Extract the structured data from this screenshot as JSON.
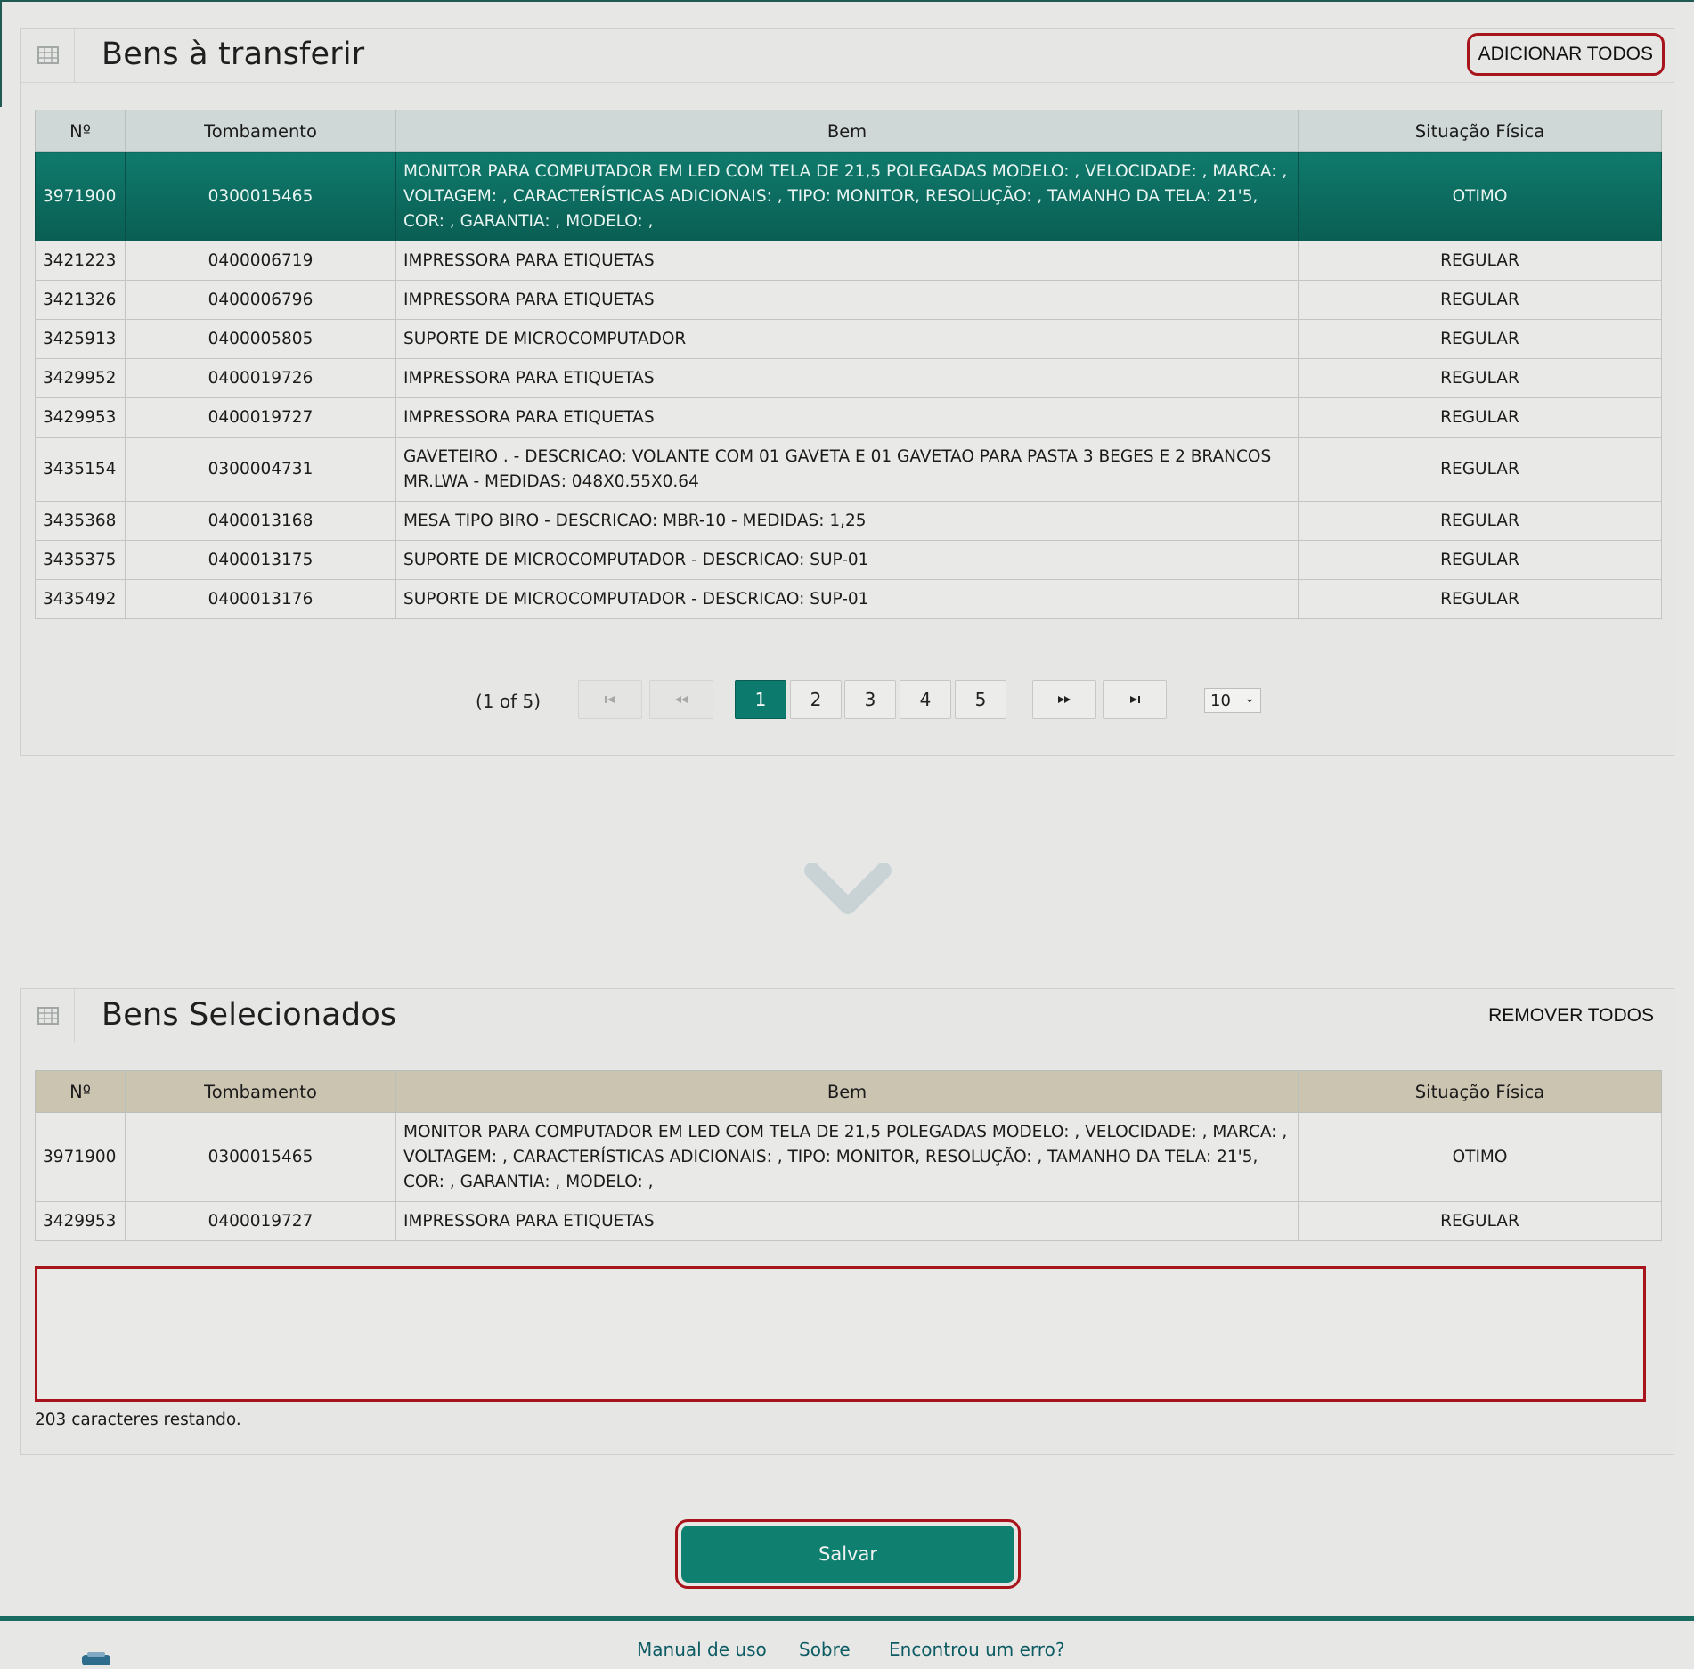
{
  "top_panel": {
    "title": "Bens à transferir",
    "action_label": "ADICIONAR TODOS",
    "columns": [
      "Nº",
      "Tombamento",
      "Bem",
      "Situação Física"
    ],
    "rows": [
      {
        "n": "3971900",
        "tomb": "0300015465",
        "bem": "MONITOR PARA COMPUTADOR EM LED COM TELA DE 21,5 POLEGADAS MODELO: , VELOCIDADE: , MARCA: , VOLTAGEM: , CARACTERÍSTICAS ADICIONAIS: , TIPO: MONITOR, RESOLUÇÃO: , TAMANHO DA TELA: 21'5, COR: , GARANTIA: , MODELO: ,",
        "sit": "OTIMO"
      },
      {
        "n": "3421223",
        "tomb": "0400006719",
        "bem": "IMPRESSORA PARA ETIQUETAS",
        "sit": "REGULAR"
      },
      {
        "n": "3421326",
        "tomb": "0400006796",
        "bem": "IMPRESSORA PARA ETIQUETAS",
        "sit": "REGULAR"
      },
      {
        "n": "3425913",
        "tomb": "0400005805",
        "bem": "SUPORTE DE MICROCOMPUTADOR",
        "sit": "REGULAR"
      },
      {
        "n": "3429952",
        "tomb": "0400019726",
        "bem": "IMPRESSORA PARA ETIQUETAS",
        "sit": "REGULAR"
      },
      {
        "n": "3429953",
        "tomb": "0400019727",
        "bem": "IMPRESSORA PARA ETIQUETAS",
        "sit": "REGULAR"
      },
      {
        "n": "3435154",
        "tomb": "0300004731",
        "bem": "GAVETEIRO . - DESCRICAO: VOLANTE COM 01 GAVETA E 01 GAVETAO PARA PASTA 3 BEGES E 2 BRANCOS MR.LWA - MEDIDAS: 048X0.55X0.64",
        "sit": "REGULAR"
      },
      {
        "n": "3435368",
        "tomb": "0400013168",
        "bem": "MESA TIPO BIRO - DESCRICAO: MBR-10 - MEDIDAS: 1,25",
        "sit": "REGULAR"
      },
      {
        "n": "3435375",
        "tomb": "0400013175",
        "bem": "SUPORTE DE MICROCOMPUTADOR - DESCRICAO: SUP-01",
        "sit": "REGULAR"
      },
      {
        "n": "3435492",
        "tomb": "0400013176",
        "bem": "SUPORTE DE MICROCOMPUTADOR - DESCRICAO: SUP-01",
        "sit": "REGULAR"
      }
    ],
    "paginator": {
      "info": "(1 of 5)",
      "first": "⏮",
      "prev": "◀◀",
      "pages": [
        "1",
        "2",
        "3",
        "4",
        "5"
      ],
      "current_page": "1",
      "next": "▶▶",
      "last": "⏭",
      "rows_per_page": "10"
    }
  },
  "bottom_panel": {
    "title": "Bens Selecionados",
    "action_label": "REMOVER TODOS",
    "columns": [
      "Nº",
      "Tombamento",
      "Bem",
      "Situação Física"
    ],
    "rows": [
      {
        "n": "3971900",
        "tomb": "0300015465",
        "bem": "MONITOR PARA COMPUTADOR EM LED COM TELA DE 21,5 POLEGADAS MODELO: , VELOCIDADE: , MARCA: , VOLTAGEM: , CARACTERÍSTICAS ADICIONAIS: , TIPO: MONITOR, RESOLUÇÃO: , TAMANHO DA TELA: 21'5, COR: , GARANTIA: , MODELO: ,",
        "sit": "OTIMO"
      },
      {
        "n": "3429953",
        "tomb": "0400019727",
        "bem": "IMPRESSORA PARA ETIQUETAS",
        "sit": "REGULAR"
      }
    ],
    "textarea_value": "",
    "remaining_text": "203 caracteres restando."
  },
  "save_label": "Salvar",
  "footer": {
    "links": [
      "Manual de uso",
      "Sobre",
      "Encontrou um erro?"
    ]
  },
  "icons": {
    "panel": "table-icon",
    "divider": "chevron-down-icon",
    "logo": "logo-icon"
  },
  "colors": {
    "accent": "#0f7f70",
    "selected_row": "#0c6f62",
    "highlight": "#a8141b",
    "top_header": "#cfd8d6",
    "bottom_header": "#cbc4b1"
  }
}
